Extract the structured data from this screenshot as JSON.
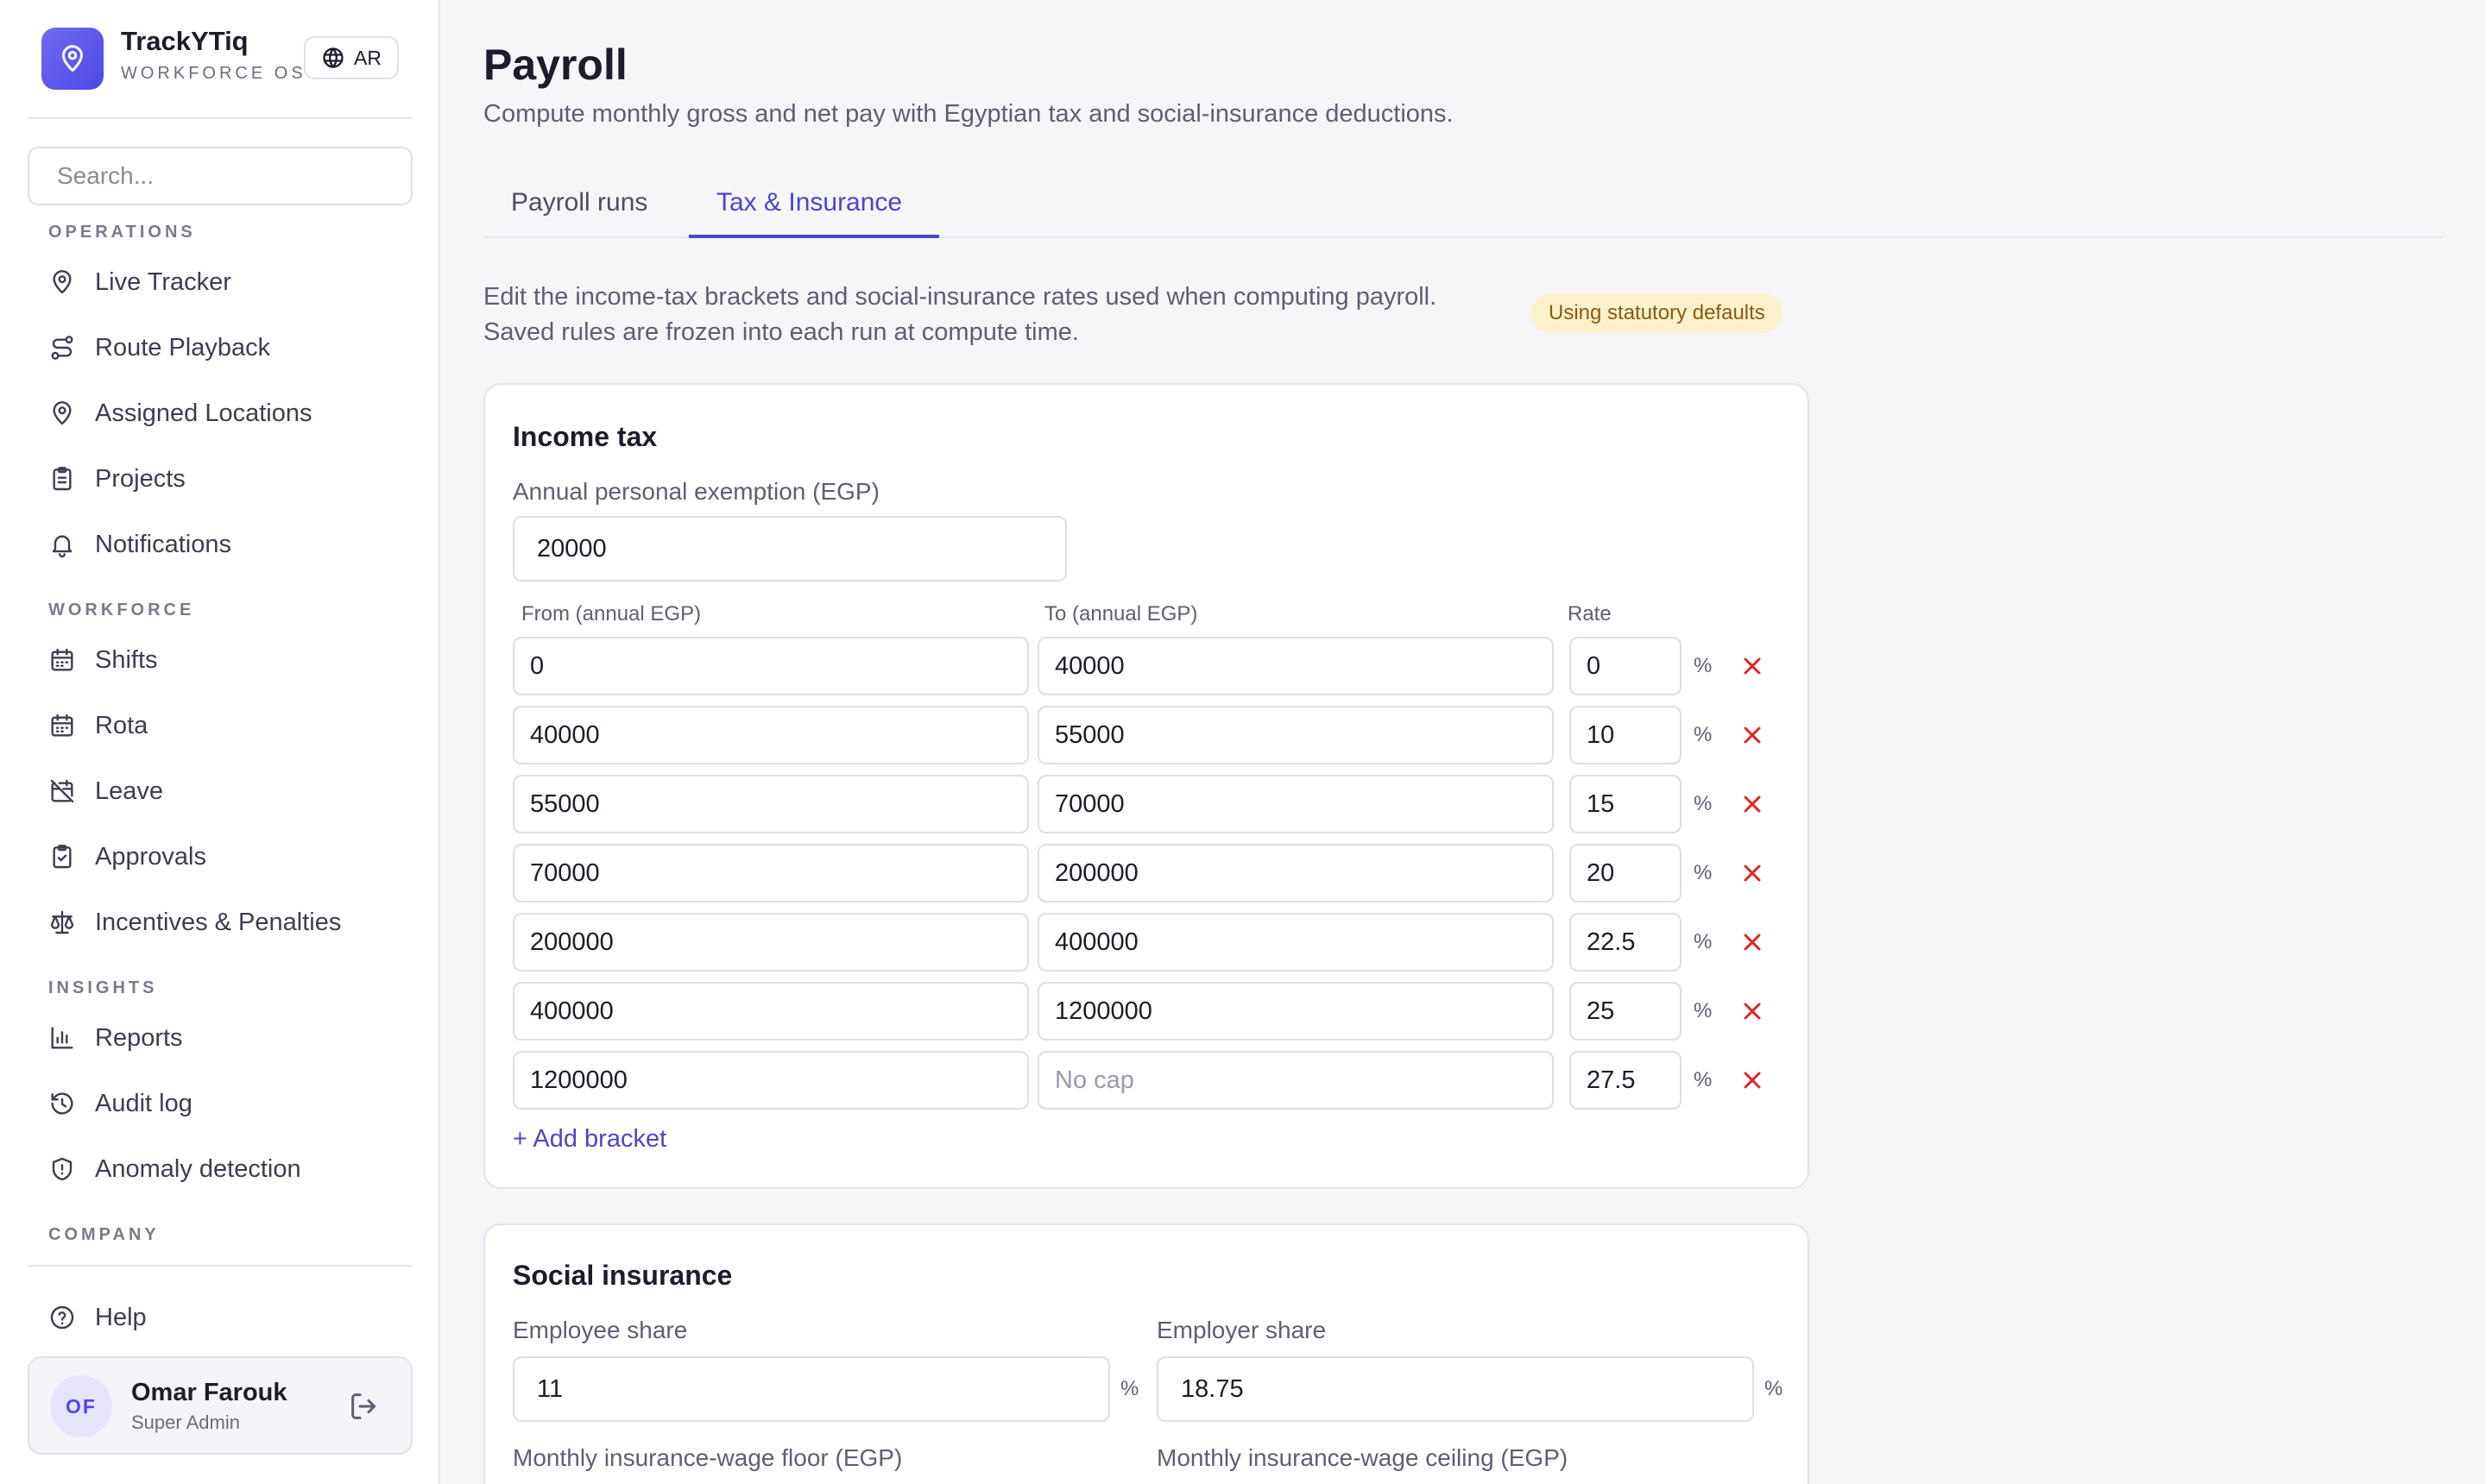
{
  "brand": {
    "name": "TrackYTiq",
    "subtitle": "WORKFORCE OS",
    "lang_label": "AR"
  },
  "search": {
    "placeholder": "Search..."
  },
  "sidebar": {
    "sections": [
      {
        "title": "OPERATIONS",
        "items": [
          "Live Tracker",
          "Route Playback",
          "Assigned Locations",
          "Projects",
          "Notifications"
        ]
      },
      {
        "title": "WORKFORCE",
        "items": [
          "Shifts",
          "Rota",
          "Leave",
          "Approvals",
          "Incentives & Penalties"
        ]
      },
      {
        "title": "INSIGHTS",
        "items": [
          "Reports",
          "Audit log",
          "Anomaly detection"
        ]
      },
      {
        "title": "COMPANY",
        "items": []
      }
    ],
    "help": "Help",
    "user": {
      "initials": "OF",
      "name": "Omar Farouk",
      "role": "Super Admin"
    }
  },
  "page": {
    "title": "Payroll",
    "subtitle": "Compute monthly gross and net pay with Egyptian tax and social-insurance deductions."
  },
  "tabs": [
    {
      "label": "Payroll runs",
      "active": false
    },
    {
      "label": "Tax & Insurance",
      "active": true
    }
  ],
  "intro": {
    "line1": "Edit the income-tax brackets and social-insurance rates used when computing payroll.",
    "line2": "Saved rules are frozen into each run at compute time.",
    "badge": "Using statutory defaults"
  },
  "income_tax": {
    "title": "Income tax",
    "exemption_label": "Annual personal exemption (EGP)",
    "exemption_value": "20000",
    "col_from": "From (annual EGP)",
    "col_to": "To (annual EGP)",
    "col_rate": "Rate",
    "pct_symbol": "%",
    "to_placeholder": "No cap",
    "brackets": [
      {
        "from": "0",
        "to": "40000",
        "rate": "0"
      },
      {
        "from": "40000",
        "to": "55000",
        "rate": "10"
      },
      {
        "from": "55000",
        "to": "70000",
        "rate": "15"
      },
      {
        "from": "70000",
        "to": "200000",
        "rate": "20"
      },
      {
        "from": "200000",
        "to": "400000",
        "rate": "22.5"
      },
      {
        "from": "400000",
        "to": "1200000",
        "rate": "25"
      },
      {
        "from": "1200000",
        "to": "",
        "rate": "27.5"
      }
    ],
    "add_label": "+ Add bracket"
  },
  "social_insurance": {
    "title": "Social insurance",
    "employee_label": "Employee share",
    "employee_value": "11",
    "employer_label": "Employer share",
    "employer_value": "18.75",
    "pct_symbol": "%",
    "floor_label": "Monthly insurance-wage floor (EGP)",
    "ceiling_label": "Monthly insurance-wage ceiling (EGP)"
  },
  "colors": {
    "accent": "#4a47c9",
    "danger": "#dc2626",
    "badge_bg": "#fdf1cc"
  }
}
